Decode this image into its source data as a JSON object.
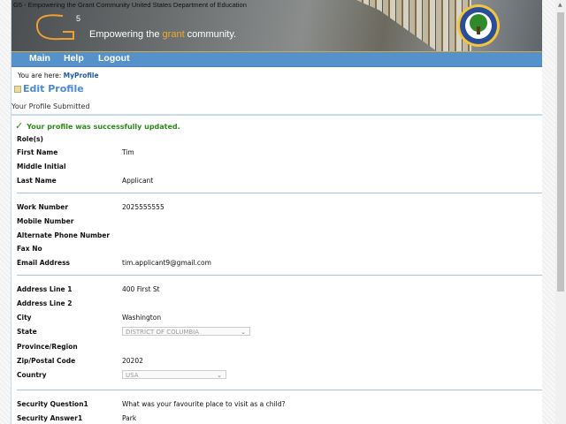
{
  "header": {
    "alt_text": "G5 - Empowering the Grant Community",
    "alt_text2": "United States Department of Education",
    "tagline_pre": "Empowering the ",
    "tagline_accent": "grant",
    "tagline_post": " community.",
    "accent": "#f0a830"
  },
  "nav": {
    "items": [
      "Main",
      "Help",
      "Logout"
    ],
    "color": "#5592cc"
  },
  "breadcrumb": {
    "prefix": "You are here: ",
    "current": "MyProfile"
  },
  "page_title": "Edit Profile",
  "section_title": "Your Profile Submitted",
  "success_message": "Your profile was successfully updated.",
  "fields": [
    {
      "label": "Role(s)",
      "value": ""
    },
    {
      "label": "First Name",
      "value": "Tim"
    },
    {
      "label": "Middle Initial",
      "value": ""
    },
    {
      "label": "Last Name",
      "value": "Applicant"
    },
    {
      "label": "Work Number",
      "value": "2025555555"
    },
    {
      "label": "Mobile Number",
      "value": ""
    },
    {
      "label": "Alternate Phone Number",
      "value": ""
    },
    {
      "label": "Fax No",
      "value": ""
    },
    {
      "label": "Email Address",
      "value": "tim.applicant9@gmail.com"
    },
    {
      "label": "Address Line 1",
      "value": "400 First St"
    },
    {
      "label": "Address Line 2",
      "value": ""
    },
    {
      "label": "City",
      "value": "Washington"
    },
    {
      "label": "State",
      "value": "DISTRICT OF COLUMBIA",
      "select": true
    },
    {
      "label": "Province/Region",
      "value": ""
    },
    {
      "label": "Zip/Postal Code",
      "value": "20202"
    },
    {
      "label": "Country",
      "value": "USA",
      "select": true
    },
    {
      "label": "Security Question1",
      "value": "What was your favourite place to visit as a child?"
    },
    {
      "label": "Security Answer1",
      "value": "Park"
    }
  ]
}
